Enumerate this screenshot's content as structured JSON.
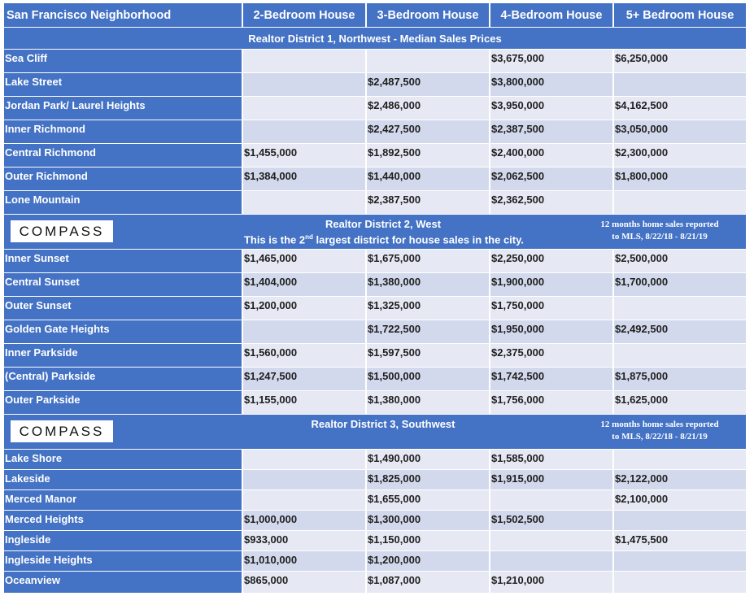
{
  "header": {
    "neighborhood": "San Francisco Neighborhood",
    "col1": "2-Bedroom House",
    "col2": "3-Bedroom House",
    "col3": "4-Bedroom House",
    "col4": "5+ Bedroom House"
  },
  "district1": {
    "title": "Realtor District 1, Northwest  - Median Sales Prices",
    "rows": [
      {
        "name": "Sea Cliff",
        "b2": "",
        "b3": "",
        "b4": "$3,675,000",
        "b5": "$6,250,000"
      },
      {
        "name": "Lake Street",
        "b2": "",
        "b3": "$2,487,500",
        "b4": "$3,800,000",
        "b5": ""
      },
      {
        "name": "Jordan Park/ Laurel Heights",
        "b2": "",
        "b3": "$2,486,000",
        "b4": "$3,950,000",
        "b5": "$4,162,500"
      },
      {
        "name": "Inner Richmond",
        "b2": "",
        "b3": "$2,427,500",
        "b4": "$2,387,500",
        "b5": "$3,050,000"
      },
      {
        "name": "Central Richmond",
        "b2": "$1,455,000",
        "b3": "$1,892,500",
        "b4": "$2,400,000",
        "b5": "$2,300,000"
      },
      {
        "name": "Outer Richmond",
        "b2": "$1,384,000",
        "b3": "$1,440,000",
        "b4": "$2,062,500",
        "b5": "$1,800,000"
      },
      {
        "name": "Lone Mountain",
        "b2": "",
        "b3": "$2,387,500",
        "b4": "$2,362,500",
        "b5": ""
      }
    ]
  },
  "district2": {
    "logo": "COMPASS",
    "title": "Realtor District 2, West",
    "subtitle_pre": "This is the 2",
    "subtitle_sup": "nd",
    "subtitle_post": " largest district for house sales in the city.",
    "note_line1": "12 months home sales reported",
    "note_line2": "to MLS, 8/22/18 - 8/21/19",
    "rows": [
      {
        "name": "Inner Sunset",
        "b2": "$1,465,000",
        "b3": "$1,675,000",
        "b4": "$2,250,000",
        "b5": "$2,500,000"
      },
      {
        "name": "Central Sunset",
        "b2": "$1,404,000",
        "b3": "$1,380,000",
        "b4": "$1,900,000",
        "b5": "$1,700,000"
      },
      {
        "name": "Outer Sunset",
        "b2": "$1,200,000",
        "b3": "$1,325,000",
        "b4": "$1,750,000",
        "b5": ""
      },
      {
        "name": "Golden Gate Heights",
        "b2": "",
        "b3": "$1,722,500",
        "b4": "$1,950,000",
        "b5": "$2,492,500"
      },
      {
        "name": "Inner Parkside",
        "b2": "$1,560,000",
        "b3": "$1,597,500",
        "b4": "$2,375,000",
        "b5": ""
      },
      {
        "name": "(Central) Parkside",
        "b2": "$1,247,500",
        "b3": "$1,500,000",
        "b4": "$1,742,500",
        "b5": "$1,875,000"
      },
      {
        "name": "Outer Parkside",
        "b2": "$1,155,000",
        "b3": "$1,380,000",
        "b4": "$1,756,000",
        "b5": "$1,625,000"
      }
    ]
  },
  "district3": {
    "logo": "COMPASS",
    "title": "Realtor District 3, Southwest",
    "note_line1": "12 months home sales reported",
    "note_line2": "to MLS, 8/22/18 - 8/21/19",
    "rows": [
      {
        "name": "Lake Shore",
        "b2": "",
        "b3": "$1,490,000",
        "b4": "$1,585,000",
        "b5": ""
      },
      {
        "name": "Lakeside",
        "b2": "",
        "b3": "$1,825,000",
        "b4": "$1,915,000",
        "b5": "$2,122,000"
      },
      {
        "name": "Merced Manor",
        "b2": "",
        "b3": "$1,655,000",
        "b4": "",
        "b5": "$2,100,000"
      },
      {
        "name": "Merced Heights",
        "b2": "$1,000,000",
        "b3": "$1,300,000",
        "b4": "$1,502,500",
        "b5": ""
      },
      {
        "name": "Ingleside",
        "b2": "$933,000",
        "b3": "$1,150,000",
        "b4": "",
        "b5": "$1,475,500"
      },
      {
        "name": "Ingleside Heights",
        "b2": "$1,010,000",
        "b3": "$1,200,000",
        "b4": "",
        "b5": ""
      },
      {
        "name": "Oceanview",
        "b2": "$865,000",
        "b3": "$1,087,000",
        "b4": "$1,210,000",
        "b5": ""
      }
    ]
  }
}
